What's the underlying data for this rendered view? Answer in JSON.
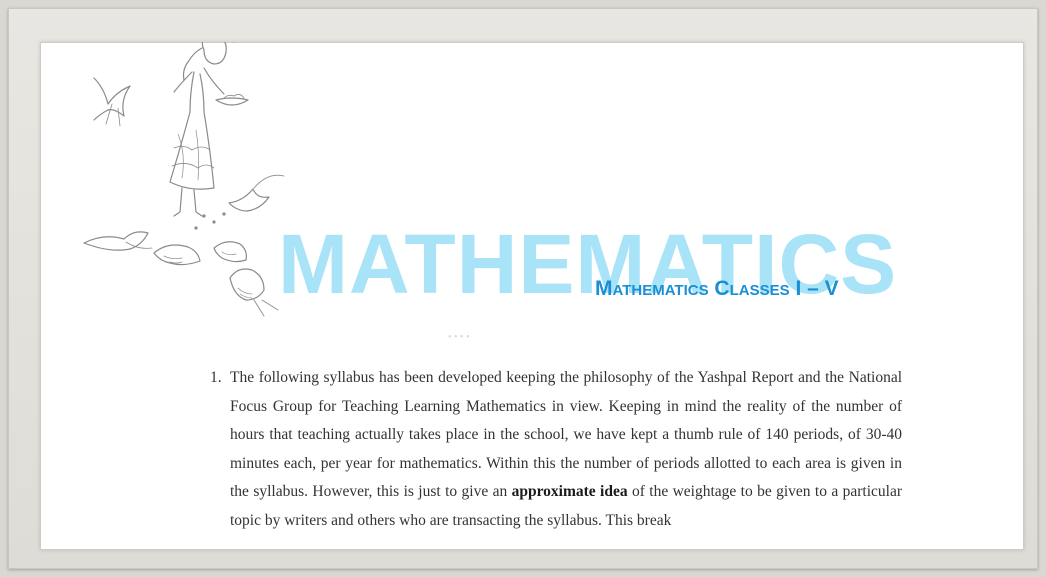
{
  "header": {
    "big_title": "MATHEMATICS",
    "subtitle": "Mathematics Classes I – V"
  },
  "illustration": {
    "description_icon": "girl-feeding-birds-illustration"
  },
  "body": {
    "item_number": "1.",
    "text_before_bold": "The following syllabus has been developed keeping the philosophy of the Yashpal Report and the National Focus Group for Teaching Learning Mathematics in view. Keeping in mind the reality of the number of hours that teaching actually takes place in the school, we have kept a thumb rule of 140 periods, of 30-40 minutes each, per year for mathematics. Within this the number of periods allotted to each area is given in the syllabus. However, this is just to give an ",
    "bold_text": "approximate idea",
    "text_after_bold": " of the weightage to be given to a particular topic by writers and others who are transacting the syllabus. This break"
  },
  "colors": {
    "title_light_blue": "#a9e3f7",
    "subtitle_blue": "#1a8fd6",
    "page_background": "#ffffff",
    "frame": "#e3e2dd"
  }
}
